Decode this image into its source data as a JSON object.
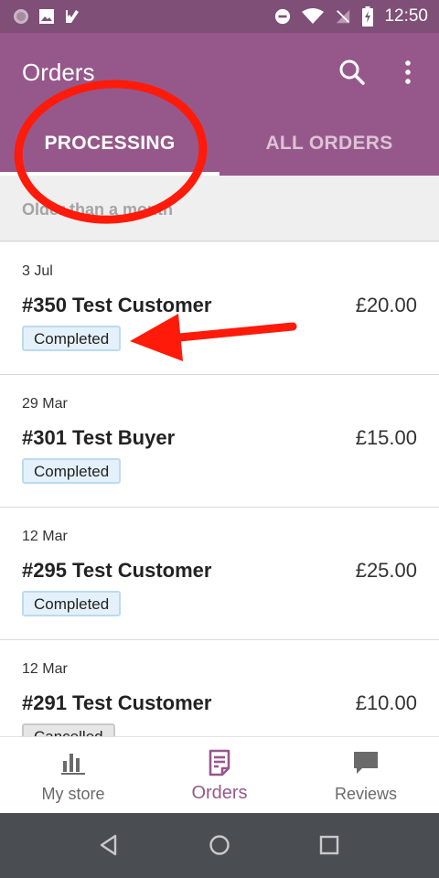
{
  "status_bar": {
    "time": "12:50",
    "left_icons": [
      "circle-icon",
      "image-icon",
      "check-flag-icon"
    ],
    "right_icons": [
      "do-not-disturb-icon",
      "wifi-icon",
      "no-signal-icon",
      "battery-charging-icon"
    ]
  },
  "app_bar": {
    "title": "Orders",
    "tabs": [
      {
        "label": "PROCESSING",
        "selected": true
      },
      {
        "label": "ALL ORDERS",
        "selected": false
      }
    ]
  },
  "section": {
    "header": "Older than a month"
  },
  "orders": [
    {
      "date": "3 Jul",
      "title": "#350  Test Customer",
      "total": "£20.00",
      "status": "Completed"
    },
    {
      "date": "29 Mar",
      "title": "#301  Test Buyer",
      "total": "£15.00",
      "status": "Completed"
    },
    {
      "date": "12 Mar",
      "title": "#295  Test Customer",
      "total": "£25.00",
      "status": "Completed"
    },
    {
      "date": "12 Mar",
      "title": "#291  Test Customer",
      "total": "£10.00",
      "status": "Cancelled"
    }
  ],
  "bottom_nav": [
    {
      "label": "My store",
      "icon": "bar-chart-icon",
      "active": false
    },
    {
      "label": "Orders",
      "icon": "orders-page-icon",
      "active": true
    },
    {
      "label": "Reviews",
      "icon": "speech-bubble-icon",
      "active": false
    }
  ],
  "colors": {
    "brand": "#96588a",
    "status_bar": "#7f4f77",
    "annotation": "#ff1a0a",
    "completed_badge": "#e5f1fa",
    "cancelled_badge": "#e6e6e6"
  }
}
